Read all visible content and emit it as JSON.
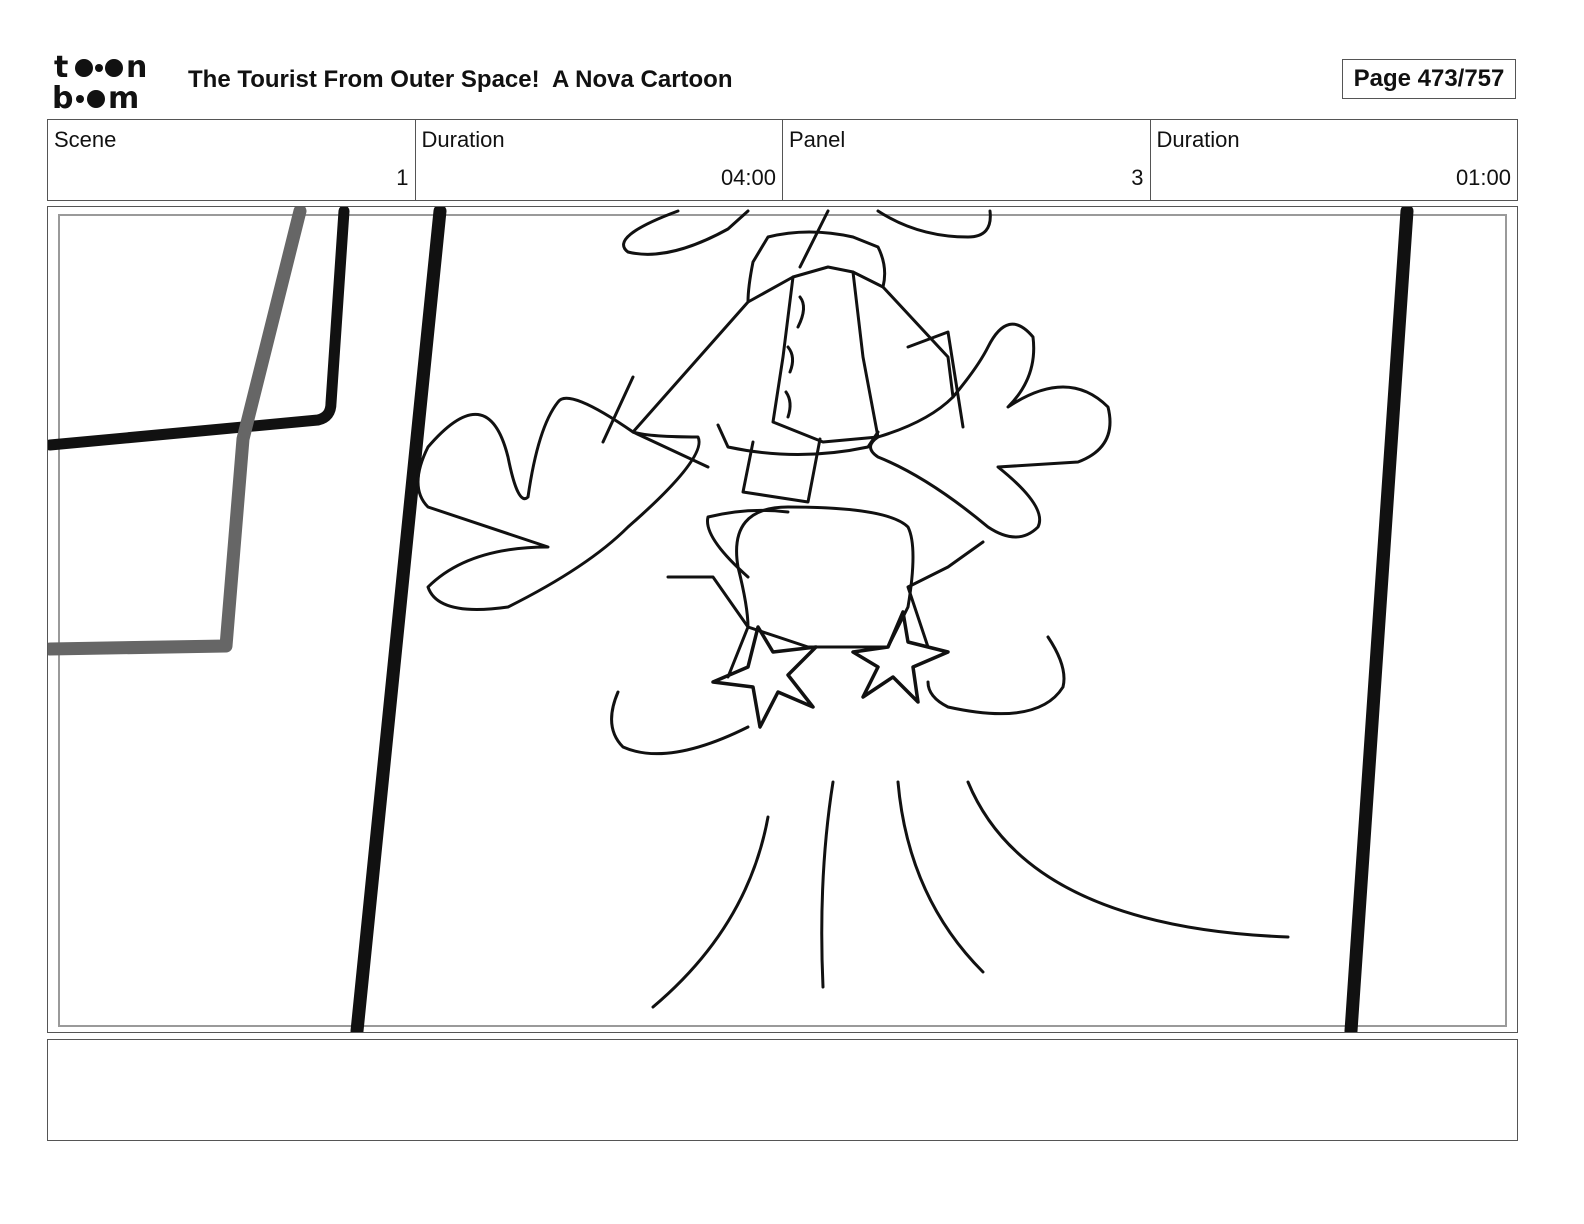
{
  "header": {
    "logo_text": "toon boom",
    "title": "The Tourist From Outer Space!  A Nova Cartoon",
    "page": "Page 473/757"
  },
  "info": {
    "scene_label": "Scene",
    "scene_value": "1",
    "scene_duration_label": "Duration",
    "scene_duration_value": "04:00",
    "panel_label": "Panel",
    "panel_value": "3",
    "panel_duration_label": "Duration",
    "panel_duration_value": "01:00"
  },
  "notes": {
    "text": ""
  }
}
